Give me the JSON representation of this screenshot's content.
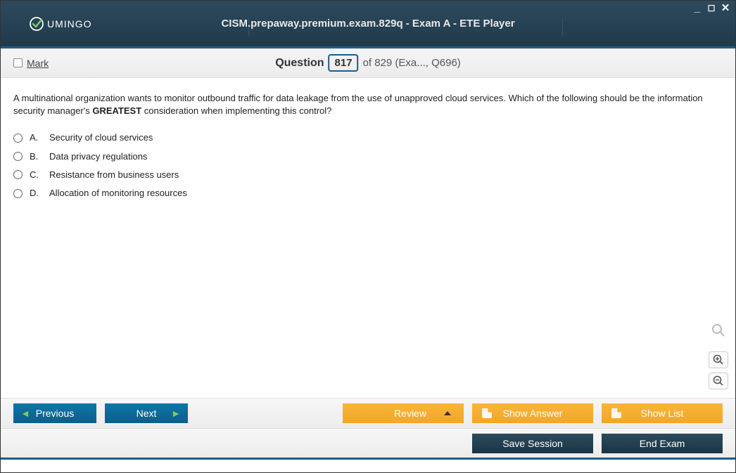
{
  "window": {
    "title": "CISM.prepaway.premium.exam.829q - Exam A - ETE Player",
    "logo_text": "UMINGO"
  },
  "question_bar": {
    "mark_label": "Mark",
    "question_label": "Question",
    "current_num": "817",
    "of_text": "of 829 (Exa..., Q696)"
  },
  "question": {
    "text_pre": "A multinational organization wants to monitor outbound traffic for data leakage from the use of unapproved cloud services. Which of the following should be the information security manager's ",
    "text_bold": "GREATEST",
    "text_post": " consideration when implementing this control?",
    "options": [
      {
        "letter": "A.",
        "text": "Security of cloud services"
      },
      {
        "letter": "B.",
        "text": "Data privacy regulations"
      },
      {
        "letter": "C.",
        "text": "Resistance from business users"
      },
      {
        "letter": "D.",
        "text": "Allocation of monitoring resources"
      }
    ]
  },
  "footer": {
    "previous": "Previous",
    "next": "Next",
    "review": "Review",
    "show_answer": "Show Answer",
    "show_list": "Show List",
    "save_session": "Save Session",
    "end_exam": "End Exam"
  }
}
